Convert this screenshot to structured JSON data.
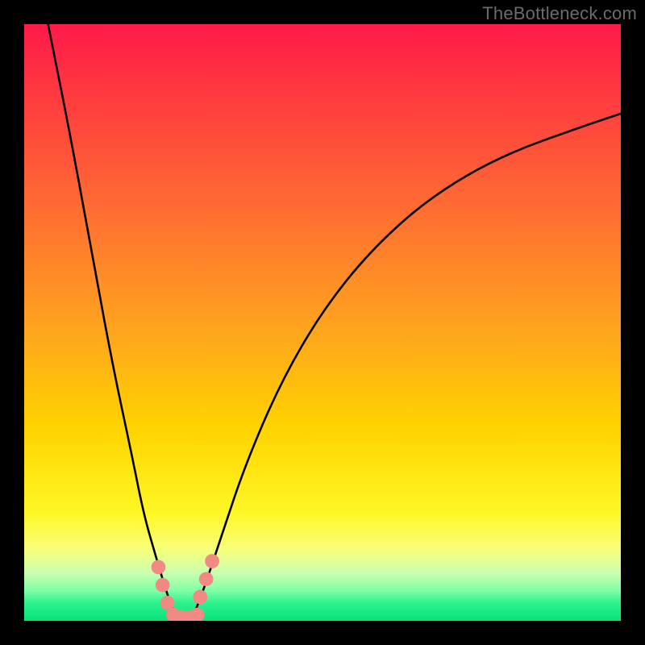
{
  "watermark": "TheBottleneck.com",
  "chart_data": {
    "type": "line",
    "title": "",
    "xlabel": "",
    "ylabel": "",
    "x_range": [
      0,
      100
    ],
    "y_range": [
      0,
      100
    ],
    "grid": false,
    "legend": false,
    "background_gradient": {
      "direction": "vertical",
      "stops": [
        {
          "pos": 0,
          "color": "#ff1a49"
        },
        {
          "pos": 30,
          "color": "#ff6a34"
        },
        {
          "pos": 50,
          "color": "#ffa11f"
        },
        {
          "pos": 70,
          "color": "#ffd400"
        },
        {
          "pos": 88,
          "color": "#f8ff7a"
        },
        {
          "pos": 95,
          "color": "#7effa6"
        },
        {
          "pos": 100,
          "color": "#08e27a"
        }
      ]
    },
    "series": [
      {
        "name": "left-branch",
        "color": "#000000",
        "x": [
          4,
          8,
          12,
          15,
          18,
          20,
          22,
          23.5,
          24.8,
          26
        ],
        "y": [
          100,
          80,
          58,
          42,
          28,
          18,
          11,
          6,
          2,
          0
        ]
      },
      {
        "name": "right-branch",
        "color": "#000000",
        "x": [
          28,
          30,
          33,
          37,
          43,
          50,
          58,
          68,
          80,
          94,
          100
        ],
        "y": [
          0,
          5,
          14,
          26,
          40,
          52,
          62,
          71,
          78,
          83,
          85
        ]
      },
      {
        "name": "valley-floor",
        "color": "#08e27a",
        "x": [
          25,
          26,
          27,
          28,
          29
        ],
        "y": [
          1.5,
          0.5,
          0.5,
          0.5,
          1.5
        ]
      }
    ],
    "markers": [
      {
        "name": "dot-l1",
        "x": 22.5,
        "y": 9,
        "r": 1.2,
        "color": "#f18a82"
      },
      {
        "name": "dot-l2",
        "x": 23.2,
        "y": 6,
        "r": 1.2,
        "color": "#f18a82"
      },
      {
        "name": "dot-l3",
        "x": 24.0,
        "y": 3,
        "r": 1.2,
        "color": "#f18a82"
      },
      {
        "name": "dot-r1",
        "x": 29.5,
        "y": 4,
        "r": 1.2,
        "color": "#f18a82"
      },
      {
        "name": "dot-r2",
        "x": 30.5,
        "y": 7,
        "r": 1.2,
        "color": "#f18a82"
      },
      {
        "name": "dot-r3",
        "x": 31.5,
        "y": 10,
        "r": 1.2,
        "color": "#f18a82"
      },
      {
        "name": "dot-b1",
        "x": 25.0,
        "y": 1.0,
        "r": 1.2,
        "color": "#f18a82"
      },
      {
        "name": "dot-b2",
        "x": 26.5,
        "y": 0.6,
        "r": 1.2,
        "color": "#f18a82"
      },
      {
        "name": "dot-b3",
        "x": 28.0,
        "y": 0.6,
        "r": 1.2,
        "color": "#f18a82"
      },
      {
        "name": "dot-b4",
        "x": 29.0,
        "y": 1.0,
        "r": 1.2,
        "color": "#f18a82"
      }
    ]
  }
}
